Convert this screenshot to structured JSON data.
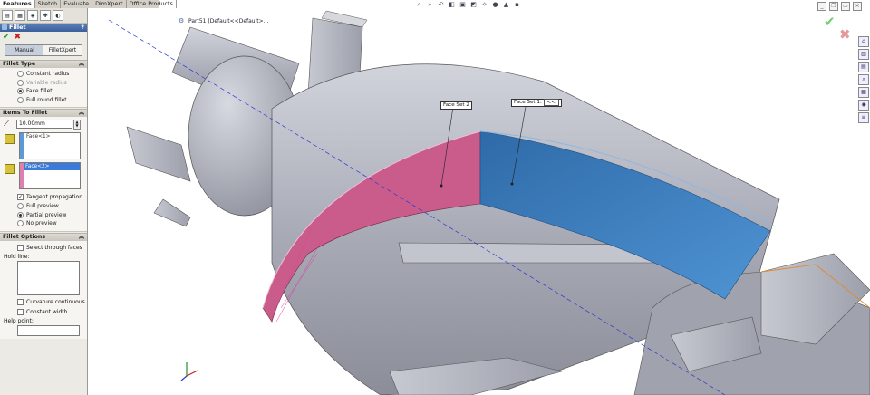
{
  "tabs": [
    {
      "label": "Features",
      "active": true
    },
    {
      "label": "Sketch",
      "active": false
    },
    {
      "label": "Evaluate",
      "active": false
    },
    {
      "label": "DimXpert",
      "active": false
    },
    {
      "label": "Office Products",
      "active": false
    }
  ],
  "feature_manager_icons": [
    "feature-tree-icon",
    "property-manager-icon",
    "configuration-manager-icon",
    "dimxpert-manager-icon",
    "display-manager-icon"
  ],
  "property_manager": {
    "title": "Fillet",
    "help_label": "?",
    "ok_label": "✔",
    "cancel_label": "✖",
    "modes": [
      {
        "label": "Manual",
        "selected": true
      },
      {
        "label": "FilletXpert",
        "selected": false
      }
    ],
    "fillet_type": {
      "header": "Fillet Type",
      "options": [
        {
          "label": "Constant radius",
          "selected": false,
          "disabled": false
        },
        {
          "label": "Variable radius",
          "selected": false,
          "disabled": true
        },
        {
          "label": "Face fillet",
          "selected": true,
          "disabled": false
        },
        {
          "label": "Full round fillet",
          "selected": false,
          "disabled": false
        }
      ]
    },
    "items_to_fillet": {
      "header": "Items To Fillet",
      "radius_value": "10.00mm",
      "face_set_1": {
        "items": [
          "Face<1>"
        ],
        "bar_color": "#5b9ad8"
      },
      "face_set_2": {
        "items": [
          "Face<2>"
        ],
        "bar_color": "#e080b0"
      },
      "tangent_propagation": {
        "label": "Tangent propagation",
        "checked": true
      },
      "preview_options": [
        {
          "label": "Full preview",
          "selected": false
        },
        {
          "label": "Partial preview",
          "selected": true
        },
        {
          "label": "No preview",
          "selected": false
        }
      ]
    },
    "fillet_options": {
      "header": "Fillet Options",
      "select_through_faces": {
        "label": "Select through faces",
        "checked": false
      },
      "hold_line_label": "Hold line:",
      "curvature_continuous": {
        "label": "Curvature continuous",
        "checked": false
      },
      "constant_width": {
        "label": "Constant width",
        "checked": false
      },
      "help_point_label": "Help point:"
    }
  },
  "viewport": {
    "feature_tree_label": "Part51 (Default<<Default>...",
    "callouts": {
      "face_set_1": "Face Set 1: ",
      "face_set_2": "Face Set 2"
    },
    "colors": {
      "body": "#b7b9c4",
      "face_set_1": "#3f7fc0",
      "face_set_2": "#c95c8a",
      "axis_line": "#2a3ad0"
    }
  }
}
